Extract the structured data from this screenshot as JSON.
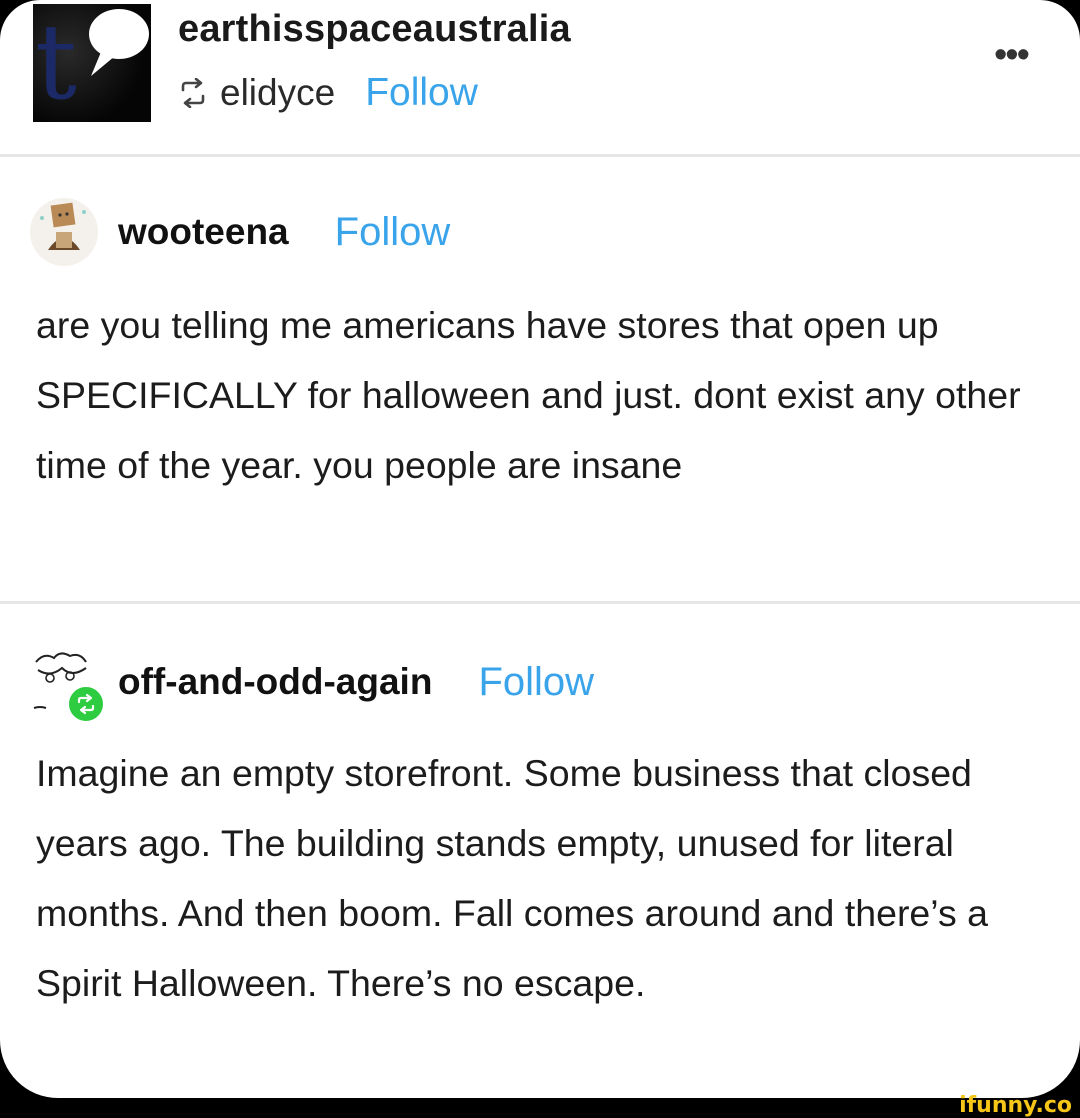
{
  "header": {
    "blog_name": "earthisspaceaustralia",
    "reblogged_from": "elidyce",
    "follow_label": "Follow",
    "more_label": "•••"
  },
  "posts": [
    {
      "username": "wooteena",
      "follow_label": "Follow",
      "body": "are you telling me americans have stores that open up SPECIFICALLY for halloween and just. dont exist any other time of the year. you people are insane"
    },
    {
      "username": "off-and-odd-again",
      "follow_label": "Follow",
      "body": "Imagine an empty storefront. Some business that closed years ago. The building stands empty, unused for literal months. And then boom. Fall comes around and there’s a Spirit Halloween. There’s no escape."
    }
  ],
  "watermark": "ifunny.co",
  "colors": {
    "follow": "#3aa4ea",
    "reblog_badge": "#2ecc40",
    "background": "#ffffff"
  },
  "icons": {
    "blog_avatar": "tumblr-t-speech-bubble-avatar",
    "reblog": "reblog-icon",
    "more": "more-dots-icon"
  }
}
